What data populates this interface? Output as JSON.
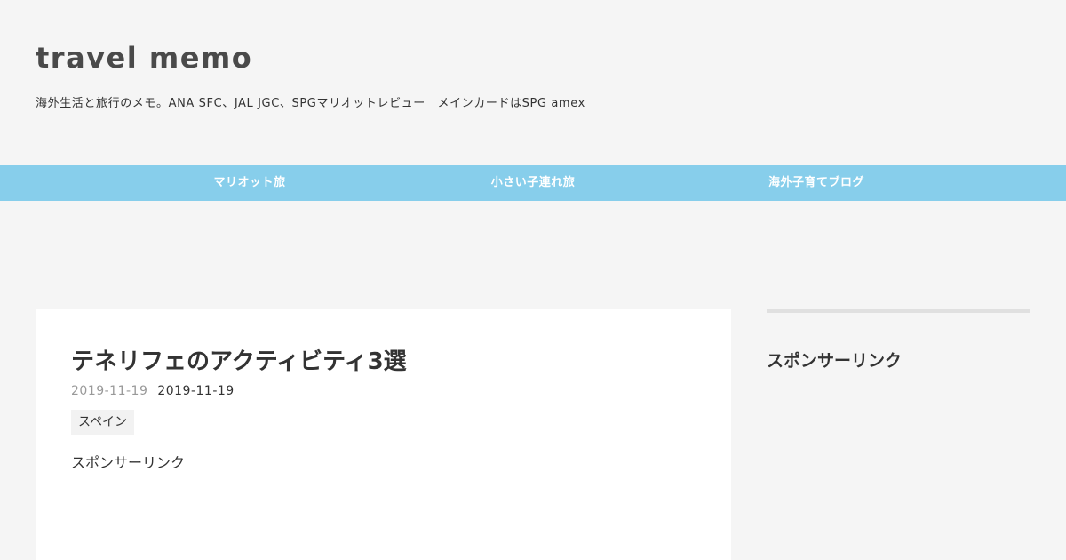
{
  "header": {
    "title": "travel memo",
    "description": "海外生活と旅行のメモ。ANA SFC、JAL JGC、SPGマリオットレビュー　メインカードはSPG amex"
  },
  "nav": {
    "items": [
      {
        "label": "マリオット旅"
      },
      {
        "label": "小さい子連れ旅"
      },
      {
        "label": "海外子育てブログ"
      }
    ]
  },
  "article": {
    "title": "テネリフェのアクティビティ3選",
    "published": "2019-11-19",
    "updated": "2019-11-19",
    "category": "スペイン",
    "sponsor_label": "スポンサーリンク"
  },
  "sidebar": {
    "widget_title": "スポンサーリンク"
  },
  "colors": {
    "background": "#f5f5f5",
    "nav": "#87ceeb",
    "content": "#ffffff",
    "text": "#333333"
  }
}
